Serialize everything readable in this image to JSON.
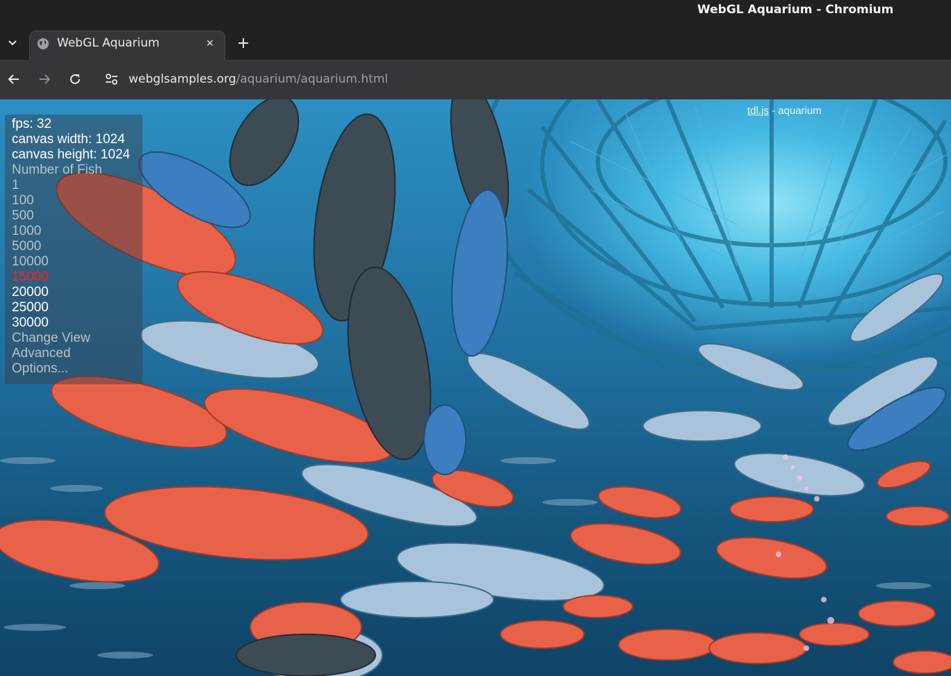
{
  "window": {
    "title": "WebGL Aquarium - Chromium"
  },
  "tab": {
    "title": "WebGL Aquarium",
    "favicon": "globe-icon",
    "close": "×"
  },
  "toolbar": {
    "url_host": "webglsamples.org",
    "url_path": "/aquarium/aquarium.html"
  },
  "overlay": {
    "fps": "fps: 32",
    "canvas_width": "canvas width: 1024",
    "canvas_height": "canvas height: 1024",
    "number_of_fish_label": "Number of Fish",
    "fish_options": [
      "1",
      "100",
      "500",
      "1000",
      "5000",
      "10000",
      "15000",
      "20000",
      "25000",
      "30000"
    ],
    "selected_option": "15000",
    "menu": [
      "Change View",
      "Advanced",
      "Options..."
    ]
  },
  "header_links": {
    "tdl": "tdl.js",
    "separator": " - ",
    "page": "aquarium"
  },
  "colors": {
    "selected": "#ff2020",
    "water": "#2c8fc2",
    "chrome_bg": "#202124"
  }
}
